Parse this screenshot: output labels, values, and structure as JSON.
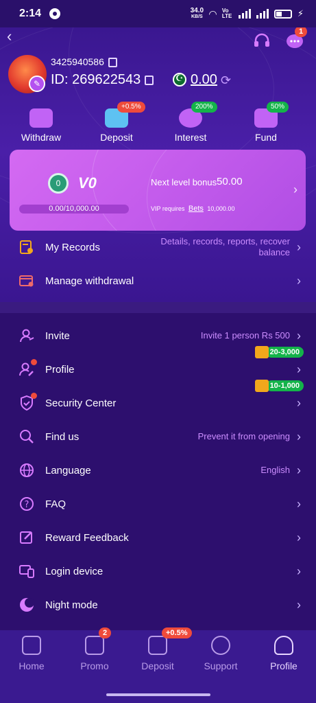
{
  "status_bar": {
    "time": "2:14",
    "net_speed": "34.0",
    "net_unit": "KB/S",
    "volte": "Vo LTE"
  },
  "header": {
    "message_badge": "1",
    "username": "3425940586",
    "id_label": "ID: 269622543",
    "balance": "0.00"
  },
  "quick_actions": [
    {
      "label": "Withdraw",
      "tag": ""
    },
    {
      "label": "Deposit",
      "tag": "+0.5%"
    },
    {
      "label": "Interest",
      "tag": "200%"
    },
    {
      "label": "Fund",
      "tag": "50%"
    }
  ],
  "vip": {
    "level": "V0",
    "medal_text": "0",
    "next_label": "Next level bonus",
    "next_value": "50.00",
    "progress_text": "0.00/10,000.00",
    "progress": 0,
    "req_prefix": "VIP requires",
    "req_link": "Bets",
    "req_value": "10,000.00"
  },
  "menu_top": [
    {
      "label": "My Records",
      "hint": "Details, records, reports, recover balance"
    },
    {
      "label": "Manage withdrawal",
      "hint": ""
    }
  ],
  "menu": [
    {
      "label": "Invite",
      "hint": "Invite 1 person Rs 500"
    },
    {
      "label": "Profile",
      "hint": "",
      "gift": "20-3,000"
    },
    {
      "label": "Security Center",
      "hint": "",
      "gift": "10-1,000"
    },
    {
      "label": "Find us",
      "hint": "Prevent it from opening"
    },
    {
      "label": "Language",
      "hint": "English"
    },
    {
      "label": "FAQ",
      "hint": ""
    },
    {
      "label": "Reward Feedback",
      "hint": ""
    },
    {
      "label": "Login device",
      "hint": ""
    },
    {
      "label": "Night mode",
      "hint": ""
    }
  ],
  "nav": [
    {
      "label": "Home",
      "badge": ""
    },
    {
      "label": "Promo",
      "badge": "2"
    },
    {
      "label": "Deposit",
      "badge": "+0.5%"
    },
    {
      "label": "Support",
      "badge": ""
    },
    {
      "label": "Profile",
      "badge": ""
    }
  ],
  "colors": {
    "accent": "#c163f5",
    "bg": "#2c0f6b",
    "badge_red": "#ef4b3b",
    "badge_green": "#14b34a"
  }
}
